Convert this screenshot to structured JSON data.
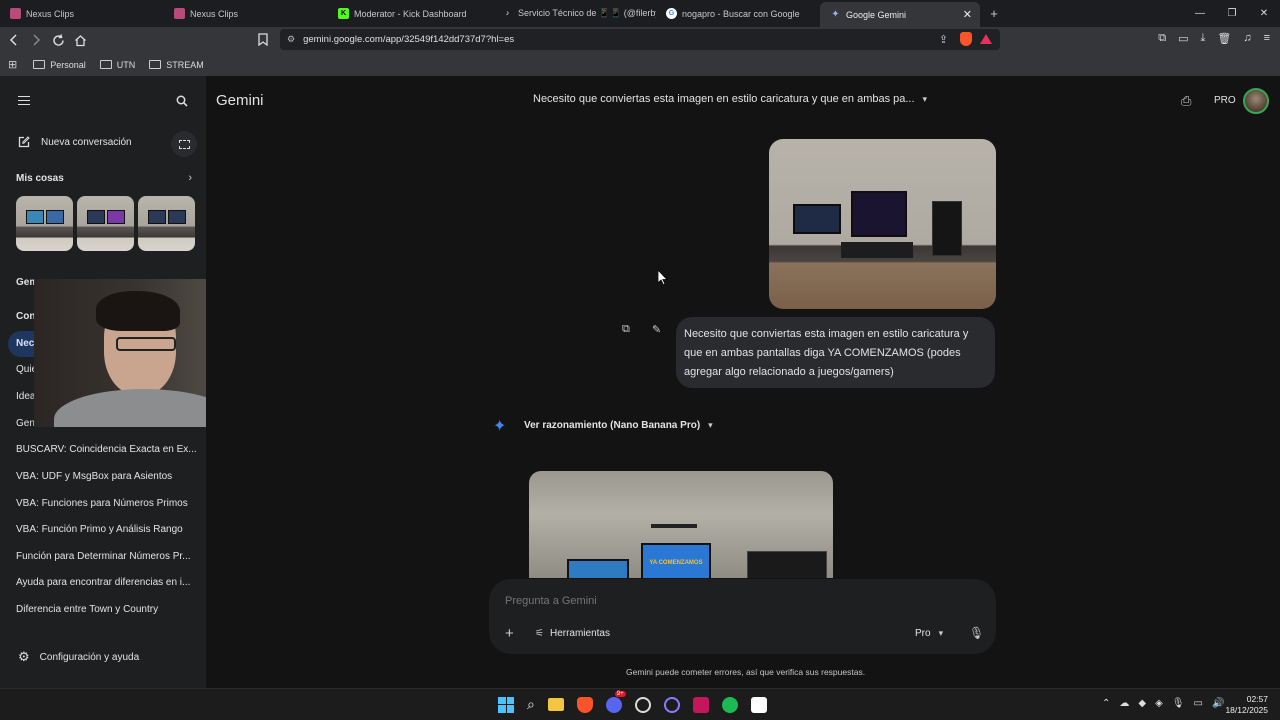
{
  "browser": {
    "tabs": [
      {
        "title": "Nexus Clips",
        "icon": "nexus-favicon",
        "color": "#b84b7a"
      },
      {
        "title": "Nexus Clips",
        "icon": "nexus-favicon",
        "color": "#b84b7a"
      },
      {
        "title": "Moderator - Kick Dashboard",
        "icon": "kick-favicon",
        "color": "#53fc18"
      },
      {
        "title": "Servicio Técnico de 📱📱 (@filerbyte",
        "icon": "tiktok-favicon",
        "color": "#ffffff"
      },
      {
        "title": "nogapro - Buscar con Google",
        "icon": "google-favicon",
        "color": "#ffffff"
      },
      {
        "title": "Google Gemini",
        "icon": "gemini-favicon",
        "color": "#8ab4f8",
        "active": true
      }
    ],
    "url": "gemini.google.com/app/32549f142dd737d7?hl=es",
    "bookmarks": [
      "Personal",
      "UTN",
      "STREAM"
    ]
  },
  "sidebar": {
    "new_chat": "Nueva conversación",
    "my_stuff": "Mis cosas",
    "gems_heading": "Gem",
    "conversations_heading": "Con",
    "conversations": [
      "Nec",
      "Quie",
      "Idea",
      "Gen",
      "BUSCARV: Coincidencia Exacta en Ex...",
      "VBA: UDF y MsgBox para Asientos",
      "VBA: Funciones para Números Primos",
      "VBA: Función Primo y Análisis Rango",
      "Función para Determinar Números Pr...",
      "Ayuda para encontrar diferencias en i...",
      "Diferencia entre Town y Country"
    ],
    "settings": "Configuración y ayuda"
  },
  "header": {
    "app_name": "Gemini",
    "chat_title": "Necesito que conviertas esta imagen en estilo caricatura y que en ambas pa...",
    "plan_badge": "PRO"
  },
  "chat": {
    "user_message": "Necesito que conviertas esta imagen en estilo caricatura y que en ambas pantallas diga YA COMENZAMOS (podes agregar algo relacionado a juegos/gamers)",
    "reasoning_label": "Ver razonamiento (Nano Banana Pro)",
    "generated_text": "YA COMENZAMOS"
  },
  "input": {
    "placeholder": "Pregunta a Gemini",
    "tools_label": "Herramientas",
    "model_label": "Pro",
    "disclaimer": "Gemini puede cometer errores, así que verifica sus respuestas."
  },
  "taskbar": {
    "time": "02:57",
    "date": "18/12/2025",
    "discord_badge": "9+"
  },
  "colors": {
    "accent_blue": "#4285f4",
    "background": "#131314",
    "sidebar": "#1e1f20",
    "bubble": "#2a2b2e"
  }
}
